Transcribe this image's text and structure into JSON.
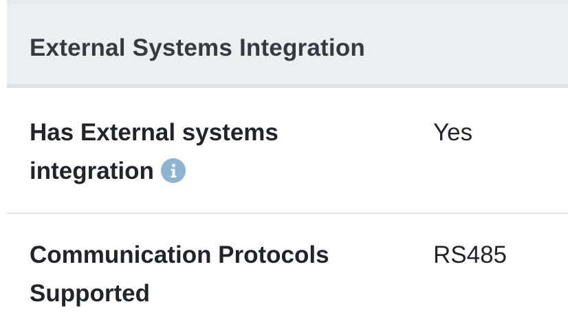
{
  "section": {
    "title": "External Systems Integration"
  },
  "specs": [
    {
      "label_line1": "Has External systems",
      "label_line2": "integration",
      "value": "Yes",
      "info_icon": "info-icon"
    },
    {
      "label_line1": "Communication Protocols",
      "label_line2": "Supported",
      "value": "RS485"
    }
  ],
  "colors": {
    "header_bg": "#eceeef",
    "info_icon": "#8fb4d1",
    "text": "#212529"
  }
}
